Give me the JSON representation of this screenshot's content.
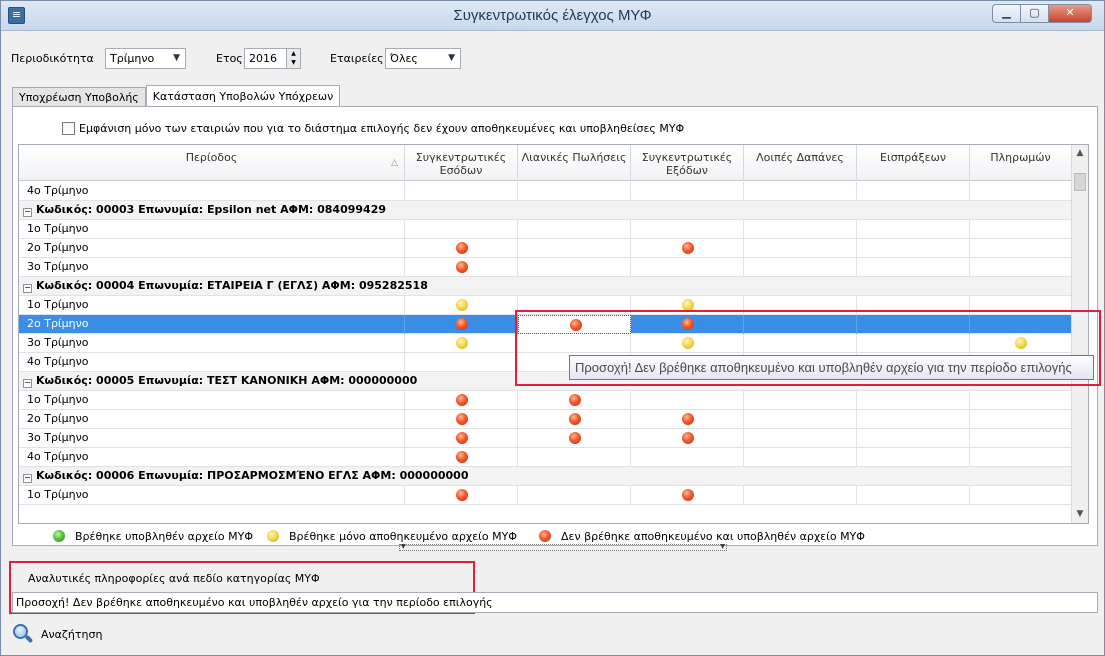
{
  "window": {
    "title": "Συγκεντρωτικός έλεγχος ΜΥΦ",
    "app_icon": "≡"
  },
  "filters": {
    "periodicity_label": "Περιοδικότητα",
    "periodicity_value": "Τρίμηνο",
    "year_label": "Ετος",
    "year_value": "2016",
    "companies_label": "Εταιρείες",
    "companies_value": "Όλες"
  },
  "tabs": [
    {
      "label": "Υποχρέωση Υποβολής",
      "active": false
    },
    {
      "label": "Κατάσταση Υποβολών Υπόχρεων",
      "active": true
    }
  ],
  "checkbox": {
    "label": "Εμφάνιση μόνο των εταιριών που για το διάστημα επιλογής δεν έχουν αποθηκευμένες και υποβληθείσες ΜΥΦ",
    "checked": false
  },
  "grid": {
    "headers": [
      "Περίοδος",
      "Συγκεντρωτικές Εσόδων",
      "Λιανικές Πωλήσεις",
      "Συγκεντρωτικές Εξόδων",
      "Λοιπές Δαπάνες",
      "Εισπράξεων",
      "Πληρωμών"
    ],
    "rows": [
      {
        "type": "data",
        "label": "4ο Τρίμηνο",
        "cells": [
          "",
          "",
          "",
          "",
          "",
          ""
        ]
      },
      {
        "type": "group",
        "label": "Κωδικός: 00003   Επωνυμία: Epsilon net   ΑΦΜ: 084099429"
      },
      {
        "type": "data",
        "label": "1ο Τρίμηνο",
        "cells": [
          "",
          "",
          "",
          "",
          "",
          ""
        ]
      },
      {
        "type": "data",
        "label": "2ο Τρίμηνο",
        "cells": [
          "red",
          "",
          "red",
          "",
          "",
          ""
        ]
      },
      {
        "type": "data",
        "label": "3ο Τρίμηνο",
        "cells": [
          "red",
          "",
          "",
          "",
          "",
          ""
        ]
      },
      {
        "type": "group",
        "label": "Κωδικός: 00004   Επωνυμία: ΕΤΑΙΡΕΙΑ Γ (ΕΓΛΣ)   ΑΦΜ: 095282518"
      },
      {
        "type": "data",
        "label": "1ο Τρίμηνο",
        "cells": [
          "yellow",
          "",
          "yellow",
          "",
          "",
          ""
        ]
      },
      {
        "type": "data",
        "label": "2ο Τρίμηνο",
        "selected": true,
        "cells": [
          "red",
          "red",
          "red",
          "",
          "",
          ""
        ]
      },
      {
        "type": "data",
        "label": "3ο Τρίμηνο",
        "cells": [
          "yellow",
          "",
          "yellow",
          "",
          "",
          "yellow"
        ]
      },
      {
        "type": "data",
        "label": "4ο Τρίμηνο",
        "cells": [
          "",
          "",
          "",
          "",
          "",
          ""
        ]
      },
      {
        "type": "group",
        "label": "Κωδικός: 00005   Επωνυμία: ΤΕΣΤ ΚΑΝΟΝΙΚΗ   ΑΦΜ: 000000000"
      },
      {
        "type": "data",
        "label": "1ο Τρίμηνο",
        "cells": [
          "red",
          "red",
          "",
          "",
          "",
          ""
        ]
      },
      {
        "type": "data",
        "label": "2ο Τρίμηνο",
        "cells": [
          "red",
          "red",
          "red",
          "",
          "",
          ""
        ]
      },
      {
        "type": "data",
        "label": "3ο Τρίμηνο",
        "cells": [
          "red",
          "red",
          "red",
          "",
          "",
          ""
        ]
      },
      {
        "type": "data",
        "label": "4ο Τρίμηνο",
        "cells": [
          "red",
          "",
          "",
          "",
          "",
          ""
        ]
      },
      {
        "type": "group",
        "label": "Κωδικός: 00006   Επωνυμία: ΠΡΟΣΑΡΜΟΣΜΈΝΟ ΕΓΛΣ   ΑΦΜ: 000000000"
      },
      {
        "type": "data",
        "label": "1ο Τρίμηνο",
        "cells": [
          "red",
          "",
          "red",
          "",
          "",
          ""
        ]
      }
    ]
  },
  "tooltip": "Προσοχή! Δεν βρέθηκε αποθηκευμένο και υποβληθέν αρχείο για την περίοδο επιλογής",
  "legend": [
    {
      "color": "green",
      "label": "Βρέθηκε υποβληθέν αρχείο ΜΥΦ"
    },
    {
      "color": "yellow",
      "label": "Βρέθηκε μόνο αποθηκευμένο αρχείο ΜΥΦ"
    },
    {
      "color": "red",
      "label": "Δεν βρέθηκε αποθηκευμένο και υποβληθέν αρχείο ΜΥΦ"
    }
  ],
  "details": {
    "label": "Αναλυτικές πληροφορίες ανά πεδίο  κατηγορίας ΜΥΦ",
    "text": "Προσοχή! Δεν βρέθηκε αποθηκευμένο και υποβληθέν αρχείο για την περίοδο επιλογής"
  },
  "search": {
    "label": "Αναζήτηση"
  },
  "colors": {
    "selection": "#3a8ee6",
    "highlight_box": "#e0203a"
  }
}
